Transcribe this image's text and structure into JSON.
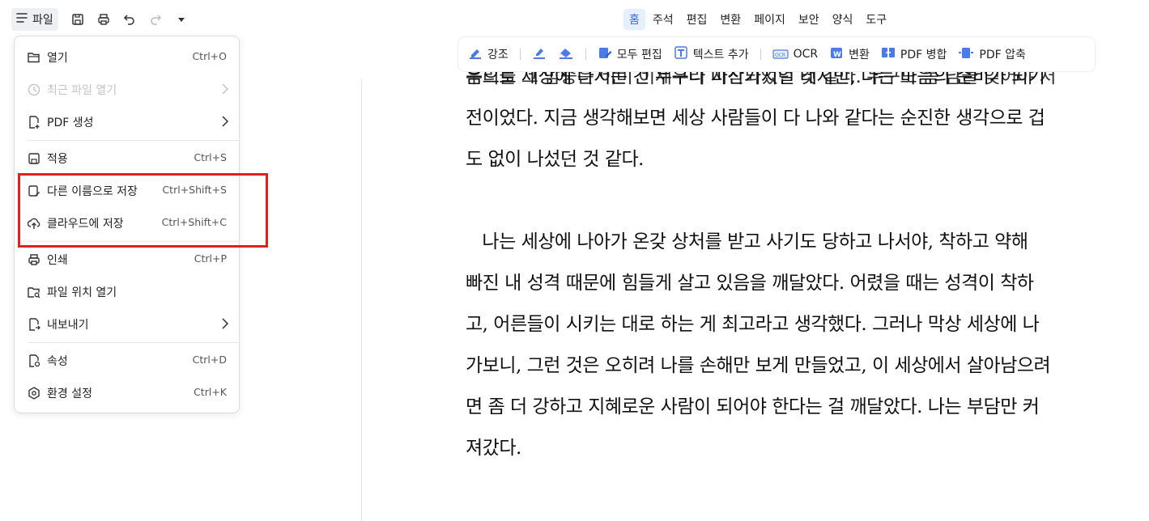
{
  "quickbar": {
    "file_label": "파일"
  },
  "tabs": [
    {
      "label": "홈",
      "active": true
    },
    {
      "label": "주석"
    },
    {
      "label": "편집"
    },
    {
      "label": "변환"
    },
    {
      "label": "페이지"
    },
    {
      "label": "보안"
    },
    {
      "label": "양식"
    },
    {
      "label": "도구"
    }
  ],
  "ribbon": {
    "highlight": "강조",
    "edit_all": "모두 편집",
    "add_text": "텍스트 추가",
    "ocr": "OCR",
    "convert": "변환",
    "merge": "PDF 병합",
    "compress": "PDF 압축"
  },
  "menu": {
    "open": {
      "label": "열기",
      "shortcut": "Ctrl+O"
    },
    "recent": {
      "label": "최근 파일 열기"
    },
    "create_pdf": {
      "label": "PDF 생성"
    },
    "apply": {
      "label": "적용",
      "shortcut": "Ctrl+S"
    },
    "save_as": {
      "label": "다른 이름으로 저장",
      "shortcut": "Ctrl+Shift+S"
    },
    "save_cloud": {
      "label": "클라우드에 저장",
      "shortcut": "Ctrl+Shift+C"
    },
    "print": {
      "label": "인쇄",
      "shortcut": "Ctrl+P"
    },
    "open_location": {
      "label": "파일 위치 열기"
    },
    "export": {
      "label": "내보내기"
    },
    "properties": {
      "label": "속성",
      "shortcut": "Ctrl+D"
    },
    "preferences": {
      "label": "환경 설정",
      "shortcut": "Ctrl+K"
    }
  },
  "document": {
    "lines": [
      "우리들 그 밤중은 이미 이제우리 시작되었던 것 같다. 누구도 몸 남을 잊어야 처",
      "음으로 세상에 나서는 건 누구나 마찬가지일 테지만, 나는 마음의 준비가 되기",
      "전이었다. 지금 생각해보면 세상 사람들이 다 나와 같다는 순진한 생각으로 겁",
      "도 없이 나섰던 것 같다.",
      "",
      "   나는 세상에 나아가 온갖 상처를 받고 사기도 당하고 나서야, 착하고 약해",
      "빠진 내 성격 때문에 힘들게 살고 있음을 깨달았다. 어렸을 때는 성격이 착하",
      "고, 어른들이 시키는 대로 하는 게 최고라고 생각했다. 그러나 막상 세상에 나",
      "가보니, 그런 것은 오히려 나를 손해만 보게 만들었고, 이 세상에서 살아남으려",
      "면 좀 더 강하고 지혜로운 사람이 되어야 한다는 걸 깨달았다. 나는 부담만 커",
      "져갔다."
    ]
  },
  "colors": {
    "accent": "#2f6be6",
    "highlight_border": "#e02020"
  }
}
